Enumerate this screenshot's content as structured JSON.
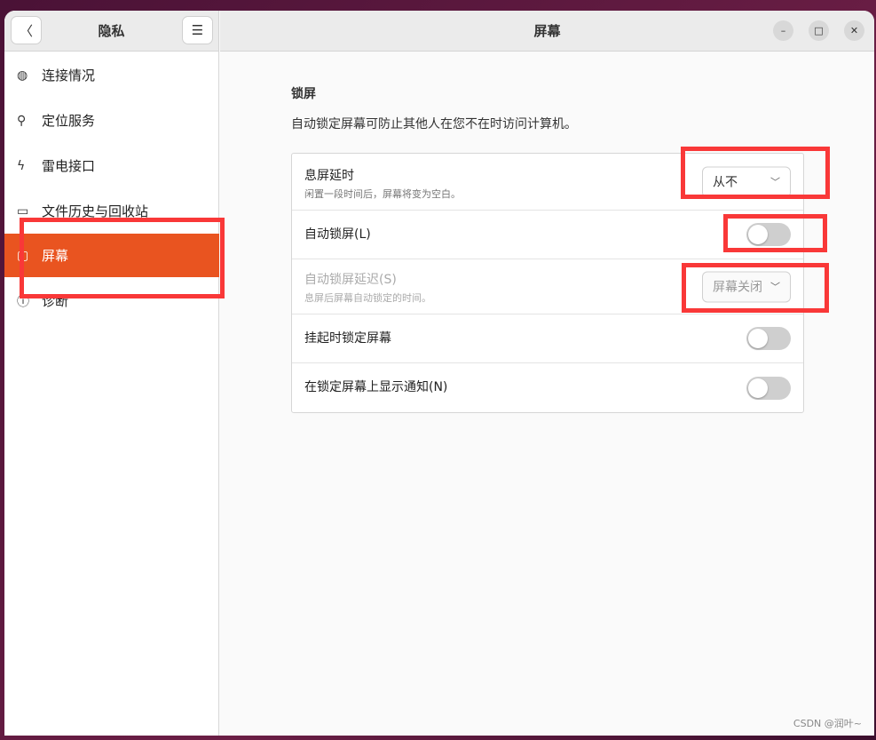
{
  "sidebar": {
    "title": "隐私",
    "items": [
      {
        "label": "连接情况",
        "icon": "globe-icon"
      },
      {
        "label": "定位服务",
        "icon": "location-pin-icon"
      },
      {
        "label": "雷电接口",
        "icon": "thunderbolt-icon"
      },
      {
        "label": "文件历史与回收站",
        "icon": "folder-icon"
      },
      {
        "label": "屏幕",
        "icon": "screen-icon",
        "selected": true
      },
      {
        "label": "诊断",
        "icon": "info-icon"
      }
    ]
  },
  "header": {
    "title": "屏幕"
  },
  "main": {
    "section_title": "锁屏",
    "section_desc": "自动锁定屏幕可防止其他人在您不在时访问计算机。",
    "rows": [
      {
        "title": "息屏延时",
        "subtitle": "闲置一段时间后，屏幕将变为空白。",
        "value": "从不"
      },
      {
        "title": "自动锁屏(L)",
        "toggle": false
      },
      {
        "title": "自动锁屏延迟(S)",
        "subtitle": "息屏后屏幕自动锁定的时间。",
        "value": "屏幕关闭",
        "disabled": true
      },
      {
        "title": "挂起时锁定屏幕",
        "toggle": false
      },
      {
        "title": "在锁定屏幕上显示通知(N)",
        "toggle": false
      }
    ]
  },
  "watermark": "CSDN @润叶~",
  "accent": "#E95420"
}
